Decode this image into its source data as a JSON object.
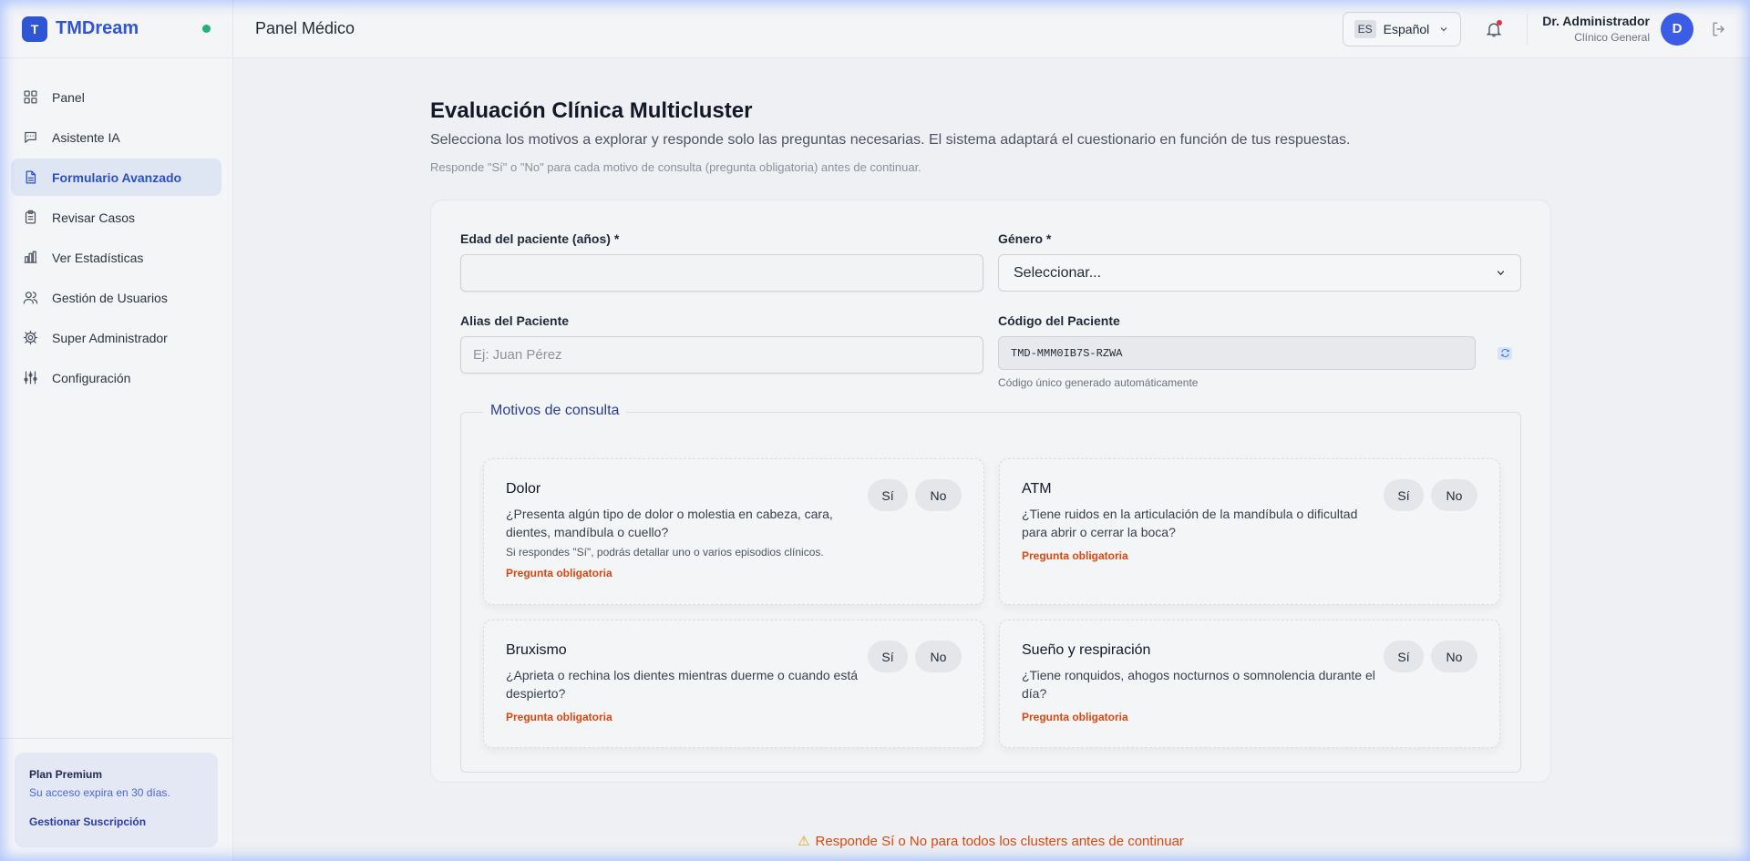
{
  "brand": {
    "name": "TMDream",
    "logo_letter": "T",
    "status_color": "#1fb37a"
  },
  "sidebar": {
    "items": [
      {
        "label": "Panel",
        "icon": "grid-icon"
      },
      {
        "label": "Asistente IA",
        "icon": "chat-icon"
      },
      {
        "label": "Formulario Avanzado",
        "icon": "document-icon",
        "active": true
      },
      {
        "label": "Revisar Casos",
        "icon": "clipboard-icon"
      },
      {
        "label": "Ver Estadísticas",
        "icon": "bar-chart-icon"
      },
      {
        "label": "Gestión de Usuarios",
        "icon": "users-icon"
      },
      {
        "label": "Super Administrador",
        "icon": "gear-icon"
      },
      {
        "label": "Configuración",
        "icon": "sliders-icon"
      }
    ],
    "plan": {
      "title": "Plan Premium",
      "subtitle": "Su acceso expira en 30 días.",
      "link": "Gestionar Suscripción"
    }
  },
  "header": {
    "title": "Panel Médico",
    "language_code": "ES",
    "language_label": "Español",
    "user_name": "Dr. Administrador",
    "user_role": "Clínico General",
    "avatar_letter": "D"
  },
  "main": {
    "title": "Evaluación Clínica Multicluster",
    "subtitle": "Selecciona los motivos a explorar y responde solo las preguntas necesarias. El sistema adaptará el cuestionario en función de tus respuestas.",
    "note": "Responde \"Sí\" o \"No\" para cada motivo de consulta (pregunta obligatoria) antes de continuar.",
    "form": {
      "age_label": "Edad del paciente (años) *",
      "age_value": "",
      "gender_label": "Género *",
      "gender_selected": "Seleccionar...",
      "alias_label": "Alias del Paciente",
      "alias_placeholder": "Ej: Juan Pérez",
      "code_label": "Código del Paciente",
      "code_value": "TMD-MMM0IB7S-RZWA",
      "code_hint": "Código único generado automáticamente"
    },
    "motivos": {
      "legend": "Motivos de consulta",
      "yes_label": "Sí",
      "no_label": "No",
      "required_label": "Pregunta obligatoria",
      "clusters": [
        {
          "title": "Dolor",
          "question": "¿Presenta algún tipo de dolor o molestia en cabeza, cara, dientes, mandíbula o cuello?",
          "hint": "Si respondes \"Sí\", podrás detallar uno o varios episodios clínicos."
        },
        {
          "title": "ATM",
          "question": "¿Tiene ruidos en la articulación de la mandíbula o dificultad para abrir o cerrar la boca?"
        },
        {
          "title": "Bruxismo",
          "question": "¿Aprieta o rechina los dientes mientras duerme o cuando está despierto?"
        },
        {
          "title": "Sueño y respiración",
          "question": "¿Tiene ronquidos, ahogos nocturnos o somnolencia durante el día?"
        }
      ]
    },
    "warning": "Responde Sí o No para todos los clusters antes de continuar"
  }
}
